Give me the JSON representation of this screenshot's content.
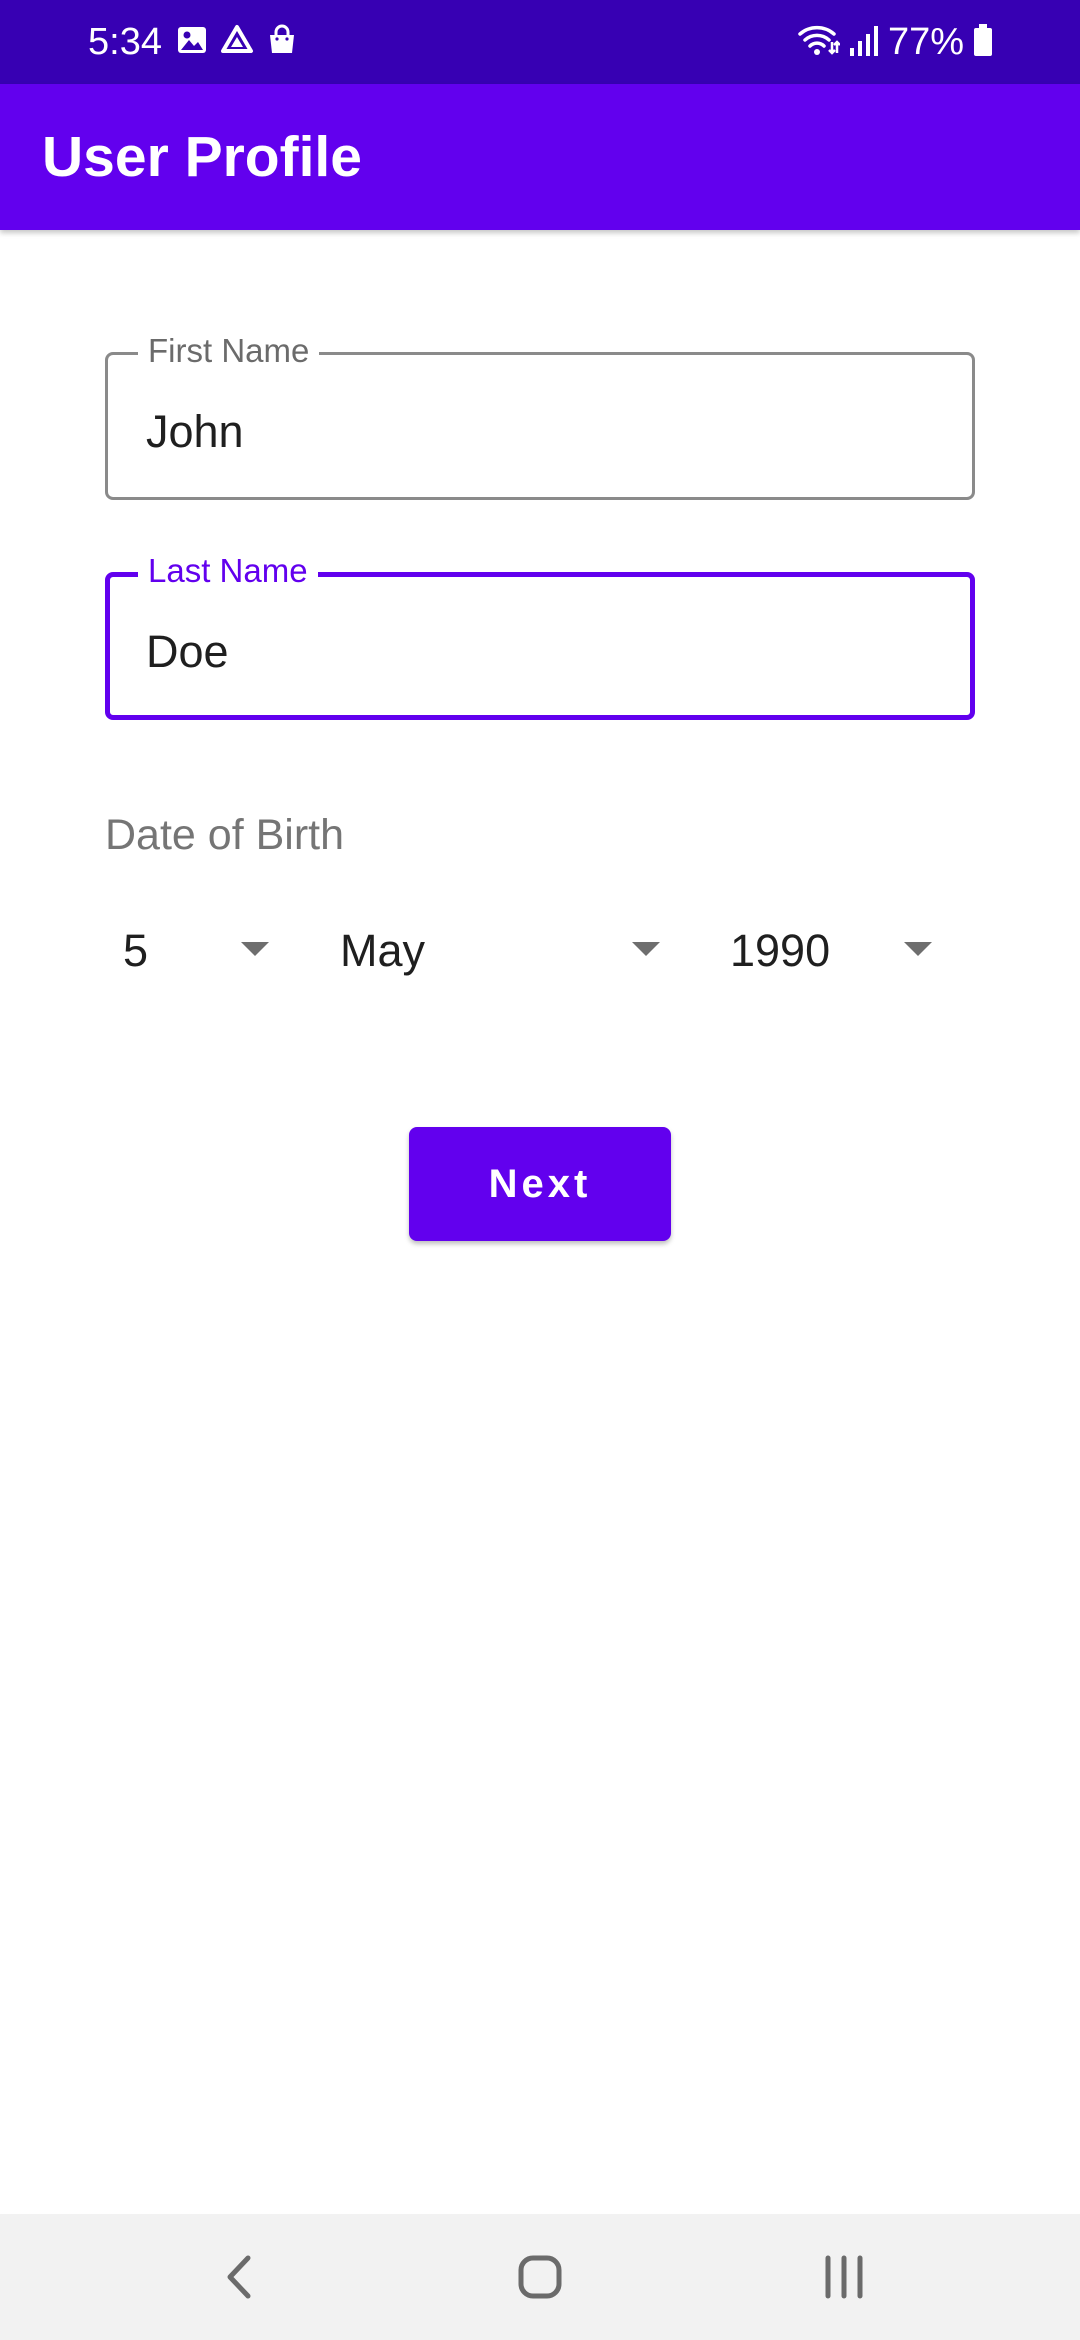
{
  "status_bar": {
    "time": "5:34",
    "battery_text": "77%",
    "left_icons": [
      "image-icon",
      "drive-icon",
      "shopping-bag-icon"
    ],
    "right_icons": [
      "wifi-icon",
      "signal-icon",
      "battery-icon"
    ]
  },
  "app_bar": {
    "title": "User Profile",
    "color": "#6200ee"
  },
  "form": {
    "first_name": {
      "label": "First Name",
      "value": "John"
    },
    "last_name": {
      "label": "Last Name",
      "value": "Doe",
      "focused": true
    },
    "dob": {
      "label": "Date of Birth",
      "day": "5",
      "month": "May",
      "year": "1990"
    },
    "next_label": "Next"
  },
  "nav_bar": {
    "buttons": [
      "back-icon",
      "home-icon",
      "recent-apps-icon"
    ]
  },
  "colors": {
    "status_bar": "#3700b3",
    "accent": "#6200ee"
  }
}
